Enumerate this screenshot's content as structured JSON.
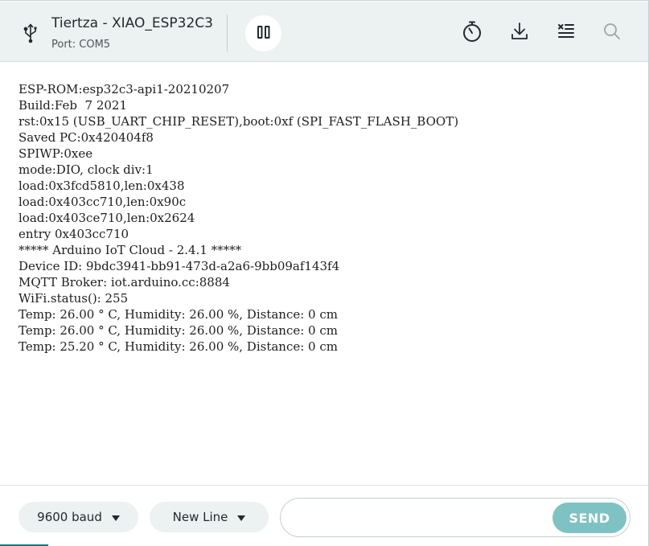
{
  "header": {
    "board_name": "Tiertza - XIAO_ESP32C3",
    "port_label": "Port: COM5",
    "icons": {
      "usb": "usb-icon",
      "pause": "pause-icon",
      "timestamp": "stopwatch-icon",
      "download": "download-icon",
      "clear": "clear-output-icon",
      "search": "search-icon"
    }
  },
  "output": {
    "lines": [
      "ESP-ROM:esp32c3-api1-20210207",
      "Build:Feb  7 2021",
      "rst:0x15 (USB_UART_CHIP_RESET),boot:0xf (SPI_FAST_FLASH_BOOT)",
      "Saved PC:0x420404f8",
      "SPIWP:0xee",
      "mode:DIO, clock div:1",
      "load:0x3fcd5810,len:0x438",
      "load:0x403cc710,len:0x90c",
      "load:0x403ce710,len:0x2624",
      "entry 0x403cc710",
      "***** Arduino IoT Cloud - 2.4.1 *****",
      "Device ID: 9bdc3941-bb91-473d-a2a6-9bb09af143f4",
      "MQTT Broker: iot.arduino.cc:8884",
      "WiFi.status(): 255",
      "Temp: 26.00 ° C, Humidity: 26.00 %, Distance: 0 cm",
      "Temp: 26.00 ° C, Humidity: 26.00 %, Distance: 0 cm",
      "Temp: 25.20 ° C, Humidity: 26.00 %, Distance: 0 cm"
    ]
  },
  "footer": {
    "baud_rate": "9600 baud",
    "line_ending": "New Line",
    "message_value": "",
    "send_label": "SEND"
  },
  "colors": {
    "header_bg": "#ecf1f1",
    "send_bg": "#7fc2c4",
    "accent": "#008184"
  }
}
